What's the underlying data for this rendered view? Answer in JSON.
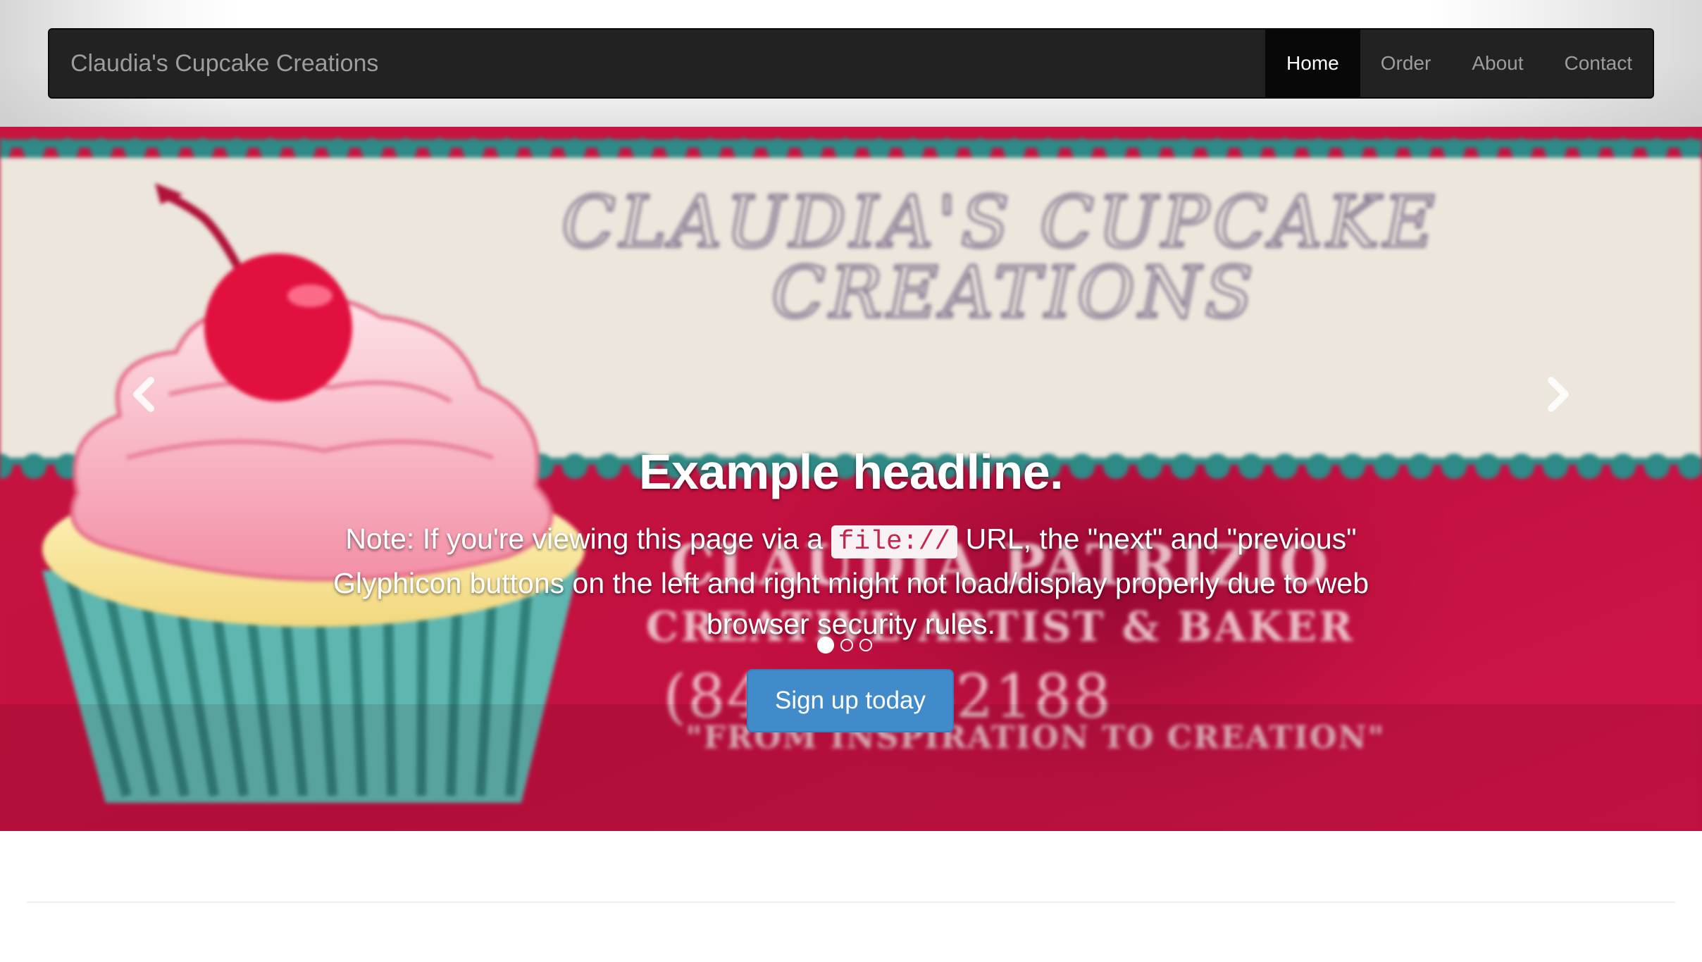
{
  "navbar": {
    "brand": "Claudia's Cupcake Creations",
    "items": [
      {
        "label": "Home",
        "active": true
      },
      {
        "label": "Order",
        "active": false
      },
      {
        "label": "About",
        "active": false
      },
      {
        "label": "Contact",
        "active": false
      }
    ]
  },
  "carousel": {
    "slide_image": {
      "title_line_1": "CLAUDIA'S CUPCAKE",
      "title_line_2": "CREATIONS",
      "name": "CLAUDIA PATRIZIO",
      "tagline": "CREATIVE ARTIST & BAKER",
      "phone": "(84_) ___-2188",
      "motto": "\"FROM INSPIRATION TO CREATION\""
    },
    "caption": {
      "headline": "Example headline.",
      "note_before": "Note: If you're viewing this page via a ",
      "note_code": "file://",
      "note_after": " URL, the \"next\" and \"previous\" Glyphicon buttons on the left and right might not load/display properly due to web browser security rules.",
      "button_label": "Sign up today"
    },
    "indicators": {
      "count": 3,
      "active_index": 0
    },
    "controls": {
      "previous_icon": "chevron-left-icon",
      "next_icon": "chevron-right-icon"
    }
  },
  "colors": {
    "navbar_bg": "#222222",
    "navbar_active_bg": "#080808",
    "banner_red": "#c8143f",
    "button_primary": "#428bca",
    "code_text": "#c7254e"
  }
}
